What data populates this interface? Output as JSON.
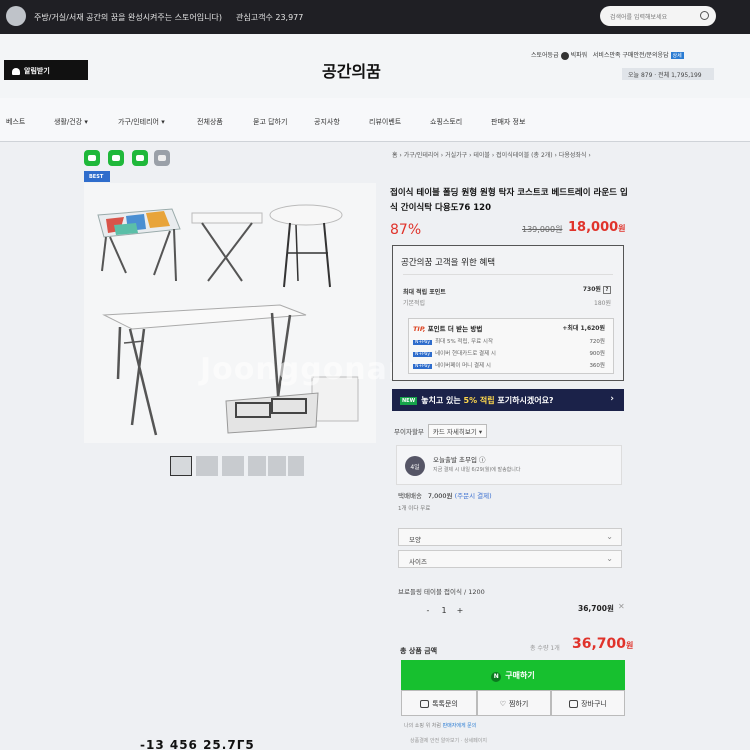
{
  "topbar": {
    "intro": "주방/거실/서재 공간의 꿈을 완성시켜주는 스토어입니다)",
    "interest_label": "관심고객수",
    "interest_count": "23,977",
    "search_placeholder": "검색어를 입력해보세요"
  },
  "header": {
    "alarm_button": "알림받기",
    "store_name": "공간의꿈",
    "grade_label": "스토어등급",
    "grade_value": "빅파워",
    "info_links": "서비스만족 구매안전/문의응답",
    "info_badge": "상세",
    "visits": "오늘 879 · 전체 1,795,199"
  },
  "nav": [
    "베스트",
    "생활/건강 ▾",
    "가구/인테리어 ▾",
    "전체상품",
    "묻고 답하기",
    "공지사항",
    "리뷰이벤트",
    "쇼핑스토리",
    "판매자 정보"
  ],
  "breadcrumb": "홈 › 가구/인테리어 › 거실가구 › 테이블 › 접이식테이블 (총 2개) › 다용성좌식 ›",
  "product": {
    "best_badge": "BEST",
    "watermark": "Joonggonara",
    "title": "접이식 테이블 폴딩 원형 원형 탁자 코스트코 베드트레이 라운드 입식 간이식탁 다용도76 120",
    "discount": "87%",
    "original_price": "139,000원",
    "sale_price": "18,000",
    "sale_unit": "원"
  },
  "benefit": {
    "title": "공간의꿈 고객을 위한 혜택",
    "max_points_label": "최대 적립 포인트",
    "max_points": "730원",
    "basic_label": "기본적립",
    "basic_value": "180원",
    "tip_word": "TIP,",
    "tip_label": "포인트 더 받는 방법",
    "tip_max": "+최대 1,620원",
    "tips": [
      {
        "badge": "N+Pay",
        "text": "최대 5% 적립, 무료 시작",
        "value": "720원"
      },
      {
        "badge": "N+Pay",
        "text": "네이버 현대카드로 결제 시",
        "value": "900원"
      },
      {
        "badge": "N+Pay",
        "text": "네이버페이 머니 결제 시",
        "value": "360원"
      }
    ]
  },
  "banner": {
    "badge": "NEW",
    "pre": "놓치고 있는",
    "pct": "5% 적립",
    "post": "포기하시겠어요?",
    "arrow": "›"
  },
  "interest_free": {
    "label": "무이자할부",
    "cards": "카드 자세히보기 ▾"
  },
  "shipping": {
    "icon": "4일",
    "title": "오늘출발 초무입 ⓘ",
    "sub": "지금 결제 시 내일 6/29(월)에 발송합니다"
  },
  "fee": {
    "label": "택배배송",
    "amount": "7,000원",
    "sub": "(주문시 결제)",
    "note": "1개 이다 무료"
  },
  "selects": [
    {
      "label": "모양",
      "chevron": "⌄"
    },
    {
      "label": "사이즈",
      "chevron": "⌄"
    }
  ],
  "option": {
    "name": "브로들링 테이블 접이식 / 1200",
    "minus": "-",
    "qty": "1",
    "plus": "+",
    "price": "36,700원",
    "remove": "✕"
  },
  "total": {
    "label": "총 상품 금액",
    "qty": "총 수량 1개",
    "amount": "36,700",
    "unit": "원"
  },
  "buttons": {
    "buy": "구매하기",
    "talk": "톡톡문의",
    "wish": "찜하기",
    "cart": "장바구니"
  },
  "footer": {
    "line1_pre": "나의 쇼핑 위 처럼",
    "line1_link": "판매자에게 문의",
    "line2": "상품결제 안전 알아보기 · 상세페이지"
  },
  "bottom_text": "-13 456    25.7Г5",
  "colors": {
    "accent_red": "#e0332b",
    "buy_green": "#17c02f",
    "banner_navy": "#1b2249",
    "topbar_dark": "#1f1f24"
  }
}
